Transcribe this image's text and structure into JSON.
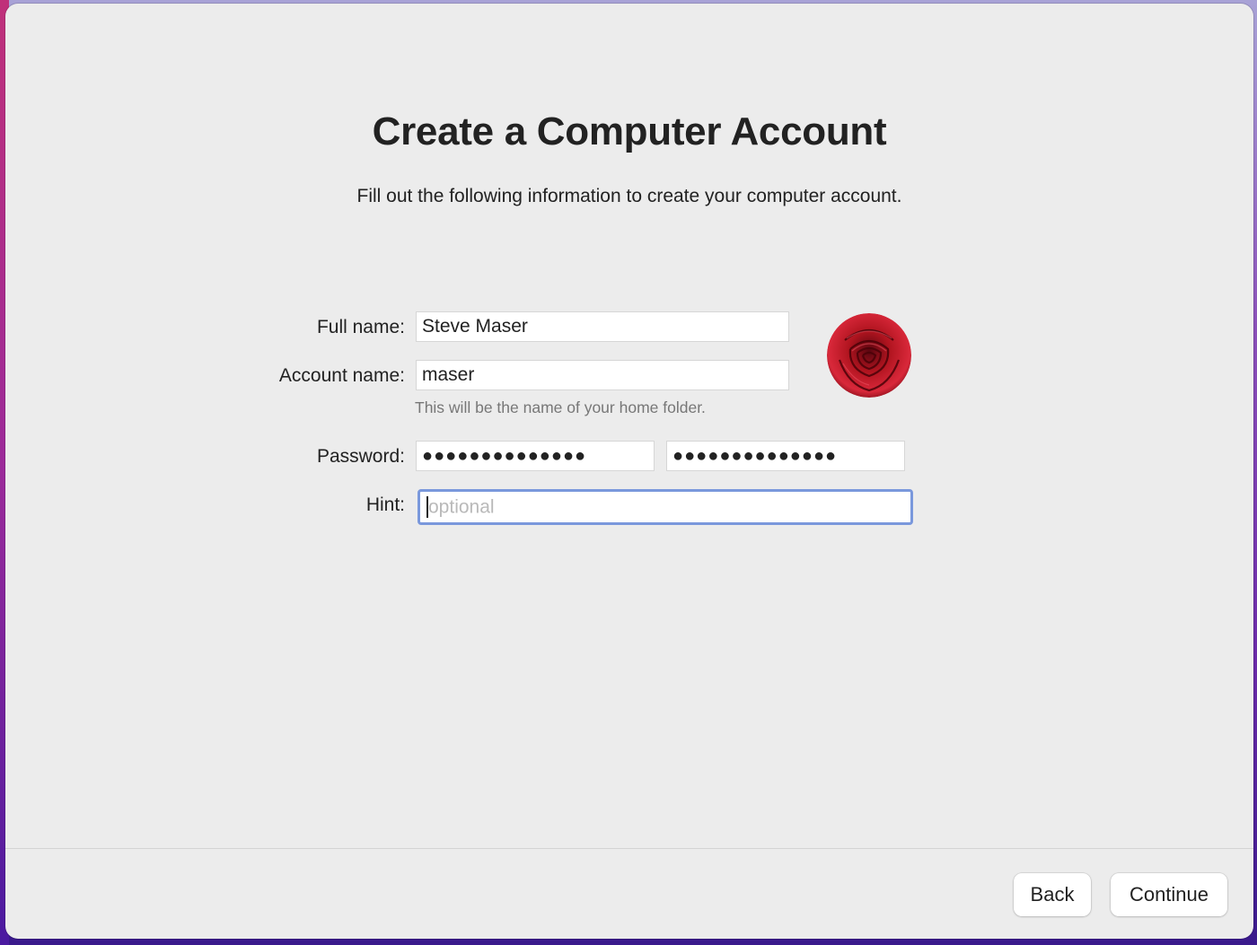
{
  "window": {
    "title": "Create a Computer Account",
    "subtitle": "Fill out the following information to create your computer account."
  },
  "form": {
    "full_name_label": "Full name:",
    "full_name_value": "Steve Maser",
    "account_name_label": "Account name:",
    "account_name_value": "maser",
    "account_name_help": "This will be the name of your home folder.",
    "password_label": "Password:",
    "password_mask": "●●●●●●●●●●●●●●",
    "verify_mask": "●●●●●●●●●●●●●●",
    "hint_label": "Hint:",
    "hint_value": "",
    "hint_placeholder": "optional"
  },
  "avatar": {
    "icon": "rose-avatar",
    "accent_color": "#c21a2c"
  },
  "footer": {
    "back_label": "Back",
    "continue_label": "Continue"
  },
  "colors": {
    "focus_ring": "#7a98dc",
    "window_bg": "#ececec"
  }
}
